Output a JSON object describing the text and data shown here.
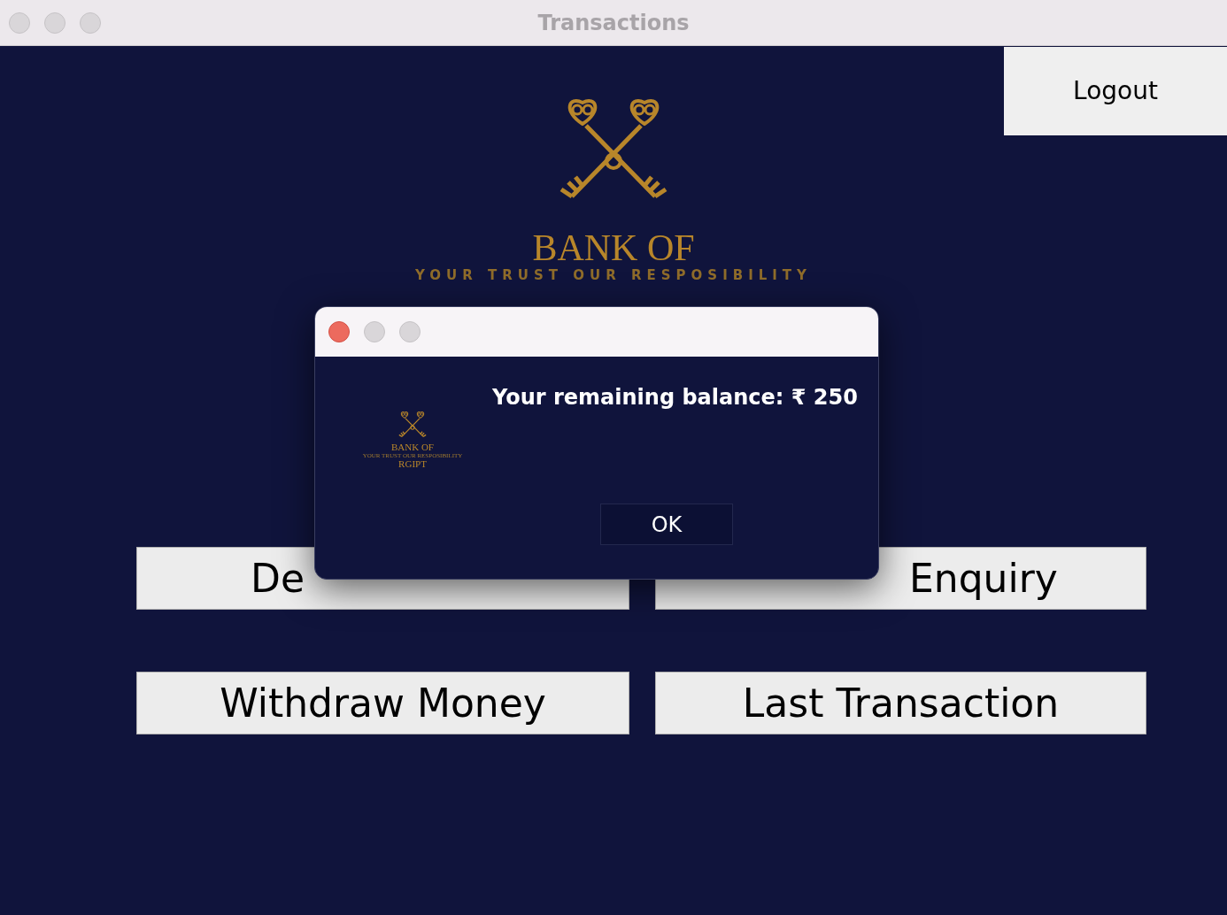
{
  "window": {
    "title": "Transactions"
  },
  "logout_button": {
    "label": "Logout"
  },
  "logo": {
    "name_line_1": "BANK OF",
    "tagline": "YOUR TRUST OUR RESPOSIBILITY"
  },
  "actions": [
    {
      "label": "De"
    },
    {
      "label": "Enquiry"
    },
    {
      "label": "Withdraw Money"
    },
    {
      "label": "Last Transaction"
    }
  ],
  "dialog": {
    "logo": {
      "name_line_1": "BANK OF",
      "tagline": "YOUR TRUST OUR RESPOSIBILITY",
      "name_line_2": "RGIPT"
    },
    "message": "Your remaining balance: ₹ 250",
    "button": "OK"
  }
}
